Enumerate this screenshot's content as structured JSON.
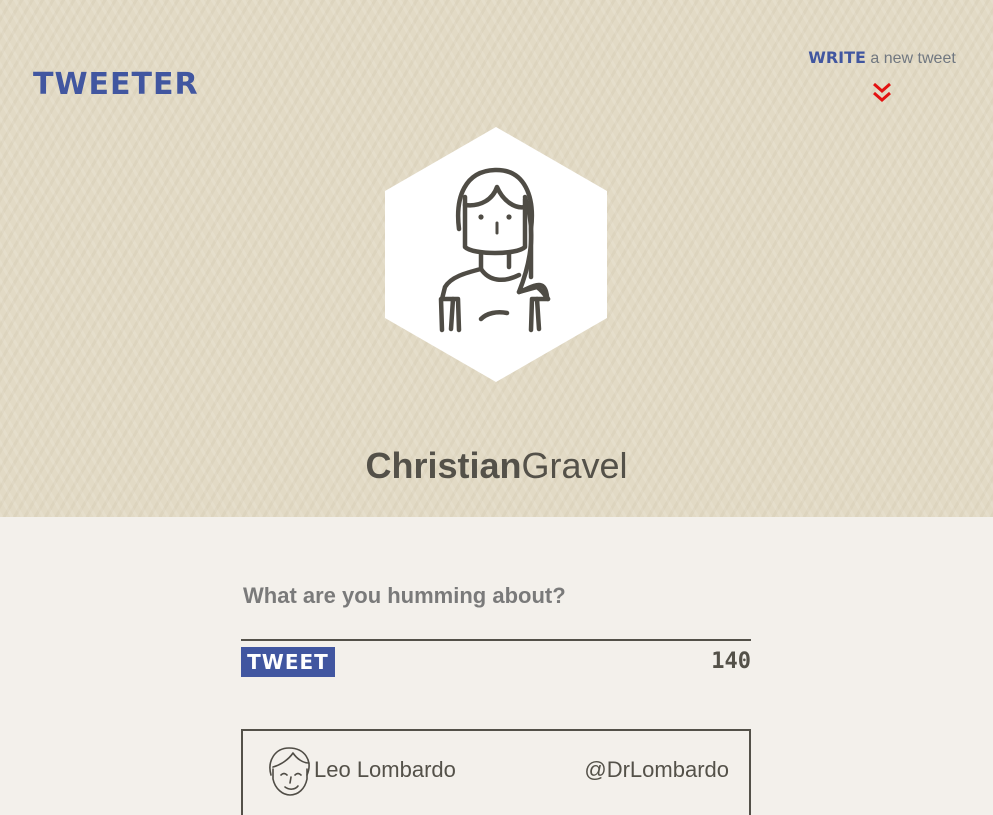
{
  "app": {
    "brand": "TWEETER"
  },
  "compose_toggle": {
    "action_word": "WRITE",
    "rest_text": " a new tweet",
    "icon": "double-chevron-down-icon"
  },
  "profile": {
    "first_name": "Christian",
    "last_name": "Gravel",
    "avatar_icon": "woman-avatar-icon"
  },
  "composer": {
    "placeholder": "What are you humming about?",
    "value": "",
    "button_label": "TWEET",
    "char_count": "140"
  },
  "tweets": [
    {
      "author": "Leo Lombardo",
      "handle": "@DrLombardo",
      "avatar_icon": "man-avatar-icon"
    }
  ],
  "colors": {
    "brand_blue": "#4156a0",
    "text_dark": "#545149",
    "chevron_red": "#e31212",
    "header_bg": "#e2dac5",
    "page_bg": "#f3f0eb"
  }
}
